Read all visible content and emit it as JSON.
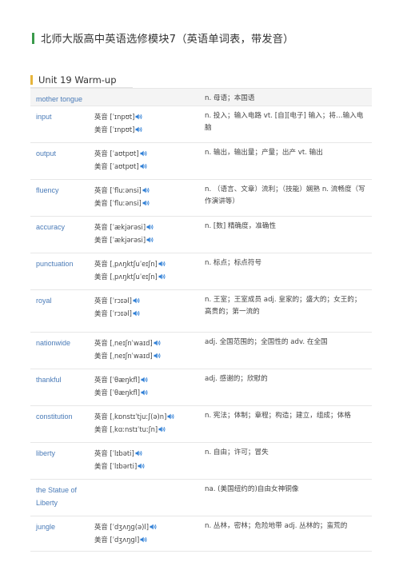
{
  "doc_title": "北师大版高中英语选修模块7（英语单词表，带发音）",
  "unit_title": "Unit 19 Warm-up",
  "colors": {
    "title_bar": "#3a9a4b",
    "unit_bar": "#e7b53c",
    "word_color": "#4a7bb8",
    "speaker_color": "#2f7fd6"
  },
  "labels": {
    "uk": "英音",
    "us": "美音"
  },
  "entries": [
    {
      "word": "mother tongue",
      "uk": "",
      "us": "",
      "meaning": "n. 母语；本国语"
    },
    {
      "word": "input",
      "uk": "[ˈɪnpʊt]",
      "us": "[ˈɪnpʊt]",
      "meaning": "n. 投入；输入电路 vt. [自][电子] 输入；将…输入电脑"
    },
    {
      "word": "output",
      "uk": "[ˈaʊtpʊt]",
      "us": "[ˈaʊtpʊt]",
      "meaning": "n. 输出，输出量；产量；出产 vt. 输出"
    },
    {
      "word": "fluency",
      "uk": "[ˈfluːənsi]",
      "us": "[ˈfluːənsi]",
      "meaning": "n. （语言、文章）流利；（技能）娴熟 n. 流畅度（写作演讲等）"
    },
    {
      "word": "accuracy",
      "uk": "[ˈækjərəsi]",
      "us": "[ˈækjərəsi]",
      "meaning": "n. [数] 精确度，准确性"
    },
    {
      "word": "punctuation",
      "uk": "[ˌpʌŋktʃuˈeɪʃn]",
      "us": "[ˌpʌŋktʃuˈeɪʃn]",
      "meaning": "n. 标点；标点符号"
    },
    {
      "word": "royal",
      "uk": "[ˈrɔɪəl]",
      "us": "[ˈrɔɪəl]",
      "meaning": "n. 王室；王室成员 adj. 皇家的；盛大的；女王的；高贵的；第一流的"
    },
    {
      "word": "nationwide",
      "uk": "[ˌneɪʃnˈwaɪd]",
      "us": "[ˌneɪʃnˈwaɪd]",
      "meaning": "adj. 全国范围的；全国性的 adv. 在全国"
    },
    {
      "word": "thankful",
      "uk": "[ˈθæŋkfl]",
      "us": "[ˈθæŋkfl]",
      "meaning": "adj. 感谢的；欣慰的"
    },
    {
      "word": "constitution",
      "uk": "[ˌkɒnstɪˈtjuːʃ(ə)n]",
      "us": "[ˌkɑːnstɪˈtuːʃn]",
      "meaning": "n. 宪法；体制；章程；构造；建立，组成；体格"
    },
    {
      "word": "liberty",
      "uk": "[ˈlɪbəti]",
      "us": "[ˈlɪbərti]",
      "meaning": "n. 自由；许可；冒失"
    },
    {
      "word": "the Statue of Liberty",
      "uk": "",
      "us": "",
      "meaning": "na. (美国纽约的)自由女神铜像"
    },
    {
      "word": "jungle",
      "uk": "[ˈdʒʌŋɡ(ə)l]",
      "us": "[ˈdʒʌŋɡl]",
      "meaning": "n. 丛林，密林；危险地带 adj. 丛林的；蛮荒的"
    }
  ]
}
